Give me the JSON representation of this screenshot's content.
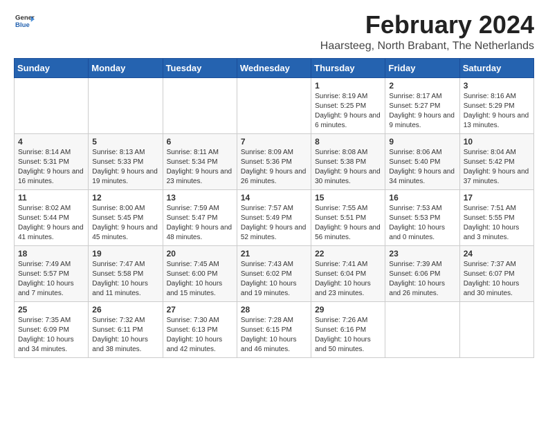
{
  "logo": {
    "general": "General",
    "blue": "Blue"
  },
  "title": "February 2024",
  "location": "Haarsteeg, North Brabant, The Netherlands",
  "days_of_week": [
    "Sunday",
    "Monday",
    "Tuesday",
    "Wednesday",
    "Thursday",
    "Friday",
    "Saturday"
  ],
  "weeks": [
    [
      {
        "day": "",
        "info": ""
      },
      {
        "day": "",
        "info": ""
      },
      {
        "day": "",
        "info": ""
      },
      {
        "day": "",
        "info": ""
      },
      {
        "day": "1",
        "info": "Sunrise: 8:19 AM\nSunset: 5:25 PM\nDaylight: 9 hours\nand 6 minutes."
      },
      {
        "day": "2",
        "info": "Sunrise: 8:17 AM\nSunset: 5:27 PM\nDaylight: 9 hours\nand 9 minutes."
      },
      {
        "day": "3",
        "info": "Sunrise: 8:16 AM\nSunset: 5:29 PM\nDaylight: 9 hours\nand 13 minutes."
      }
    ],
    [
      {
        "day": "4",
        "info": "Sunrise: 8:14 AM\nSunset: 5:31 PM\nDaylight: 9 hours\nand 16 minutes."
      },
      {
        "day": "5",
        "info": "Sunrise: 8:13 AM\nSunset: 5:33 PM\nDaylight: 9 hours\nand 19 minutes."
      },
      {
        "day": "6",
        "info": "Sunrise: 8:11 AM\nSunset: 5:34 PM\nDaylight: 9 hours\nand 23 minutes."
      },
      {
        "day": "7",
        "info": "Sunrise: 8:09 AM\nSunset: 5:36 PM\nDaylight: 9 hours\nand 26 minutes."
      },
      {
        "day": "8",
        "info": "Sunrise: 8:08 AM\nSunset: 5:38 PM\nDaylight: 9 hours\nand 30 minutes."
      },
      {
        "day": "9",
        "info": "Sunrise: 8:06 AM\nSunset: 5:40 PM\nDaylight: 9 hours\nand 34 minutes."
      },
      {
        "day": "10",
        "info": "Sunrise: 8:04 AM\nSunset: 5:42 PM\nDaylight: 9 hours\nand 37 minutes."
      }
    ],
    [
      {
        "day": "11",
        "info": "Sunrise: 8:02 AM\nSunset: 5:44 PM\nDaylight: 9 hours\nand 41 minutes."
      },
      {
        "day": "12",
        "info": "Sunrise: 8:00 AM\nSunset: 5:45 PM\nDaylight: 9 hours\nand 45 minutes."
      },
      {
        "day": "13",
        "info": "Sunrise: 7:59 AM\nSunset: 5:47 PM\nDaylight: 9 hours\nand 48 minutes."
      },
      {
        "day": "14",
        "info": "Sunrise: 7:57 AM\nSunset: 5:49 PM\nDaylight: 9 hours\nand 52 minutes."
      },
      {
        "day": "15",
        "info": "Sunrise: 7:55 AM\nSunset: 5:51 PM\nDaylight: 9 hours\nand 56 minutes."
      },
      {
        "day": "16",
        "info": "Sunrise: 7:53 AM\nSunset: 5:53 PM\nDaylight: 10 hours\nand 0 minutes."
      },
      {
        "day": "17",
        "info": "Sunrise: 7:51 AM\nSunset: 5:55 PM\nDaylight: 10 hours\nand 3 minutes."
      }
    ],
    [
      {
        "day": "18",
        "info": "Sunrise: 7:49 AM\nSunset: 5:57 PM\nDaylight: 10 hours\nand 7 minutes."
      },
      {
        "day": "19",
        "info": "Sunrise: 7:47 AM\nSunset: 5:58 PM\nDaylight: 10 hours\nand 11 minutes."
      },
      {
        "day": "20",
        "info": "Sunrise: 7:45 AM\nSunset: 6:00 PM\nDaylight: 10 hours\nand 15 minutes."
      },
      {
        "day": "21",
        "info": "Sunrise: 7:43 AM\nSunset: 6:02 PM\nDaylight: 10 hours\nand 19 minutes."
      },
      {
        "day": "22",
        "info": "Sunrise: 7:41 AM\nSunset: 6:04 PM\nDaylight: 10 hours\nand 23 minutes."
      },
      {
        "day": "23",
        "info": "Sunrise: 7:39 AM\nSunset: 6:06 PM\nDaylight: 10 hours\nand 26 minutes."
      },
      {
        "day": "24",
        "info": "Sunrise: 7:37 AM\nSunset: 6:07 PM\nDaylight: 10 hours\nand 30 minutes."
      }
    ],
    [
      {
        "day": "25",
        "info": "Sunrise: 7:35 AM\nSunset: 6:09 PM\nDaylight: 10 hours\nand 34 minutes."
      },
      {
        "day": "26",
        "info": "Sunrise: 7:32 AM\nSunset: 6:11 PM\nDaylight: 10 hours\nand 38 minutes."
      },
      {
        "day": "27",
        "info": "Sunrise: 7:30 AM\nSunset: 6:13 PM\nDaylight: 10 hours\nand 42 minutes."
      },
      {
        "day": "28",
        "info": "Sunrise: 7:28 AM\nSunset: 6:15 PM\nDaylight: 10 hours\nand 46 minutes."
      },
      {
        "day": "29",
        "info": "Sunrise: 7:26 AM\nSunset: 6:16 PM\nDaylight: 10 hours\nand 50 minutes."
      },
      {
        "day": "",
        "info": ""
      },
      {
        "day": "",
        "info": ""
      }
    ]
  ]
}
